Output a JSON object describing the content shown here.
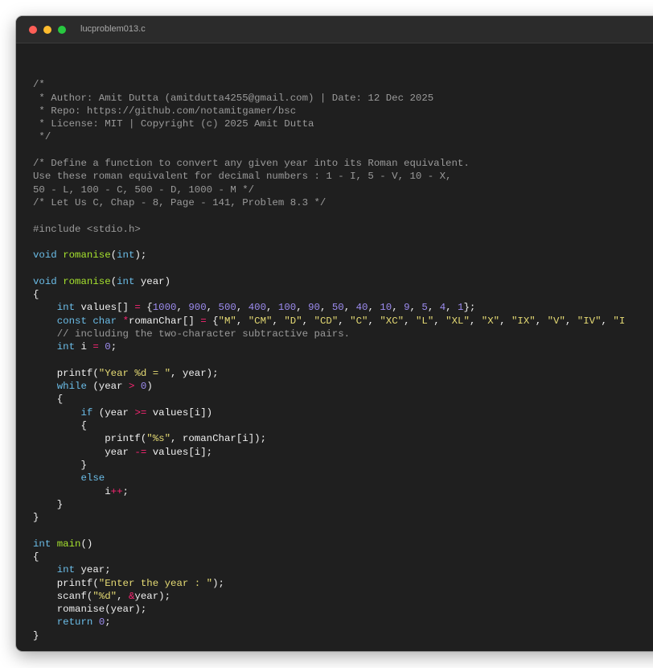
{
  "window": {
    "title": "lucproblem013.c",
    "colors": {
      "background": "#1f1f1f",
      "titlebar": "#2b2b2b",
      "close": "#ff5f57",
      "minimize": "#febc2e",
      "maximize": "#28c840"
    },
    "controls": [
      "close-icon",
      "minimize-icon",
      "maximize-icon"
    ]
  },
  "syntax_colors": {
    "comment": "#9a9a9a",
    "keyword": "#6bbde8",
    "function": "#a6e22e",
    "number": "#9d8cf0",
    "string": "#e6db74",
    "operator": "#f92672",
    "plain": "#f0f0f0"
  },
  "code_lines": [
    [],
    [
      [
        "c",
        "/*"
      ]
    ],
    [
      [
        "c",
        " * Author: Amit Dutta (amitdutta4255@gmail.com) | Date: 12 Dec 2025"
      ]
    ],
    [
      [
        "c",
        " * Repo: https://github.com/notamitgamer/bsc"
      ]
    ],
    [
      [
        "c",
        " * License: MIT | Copyright (c) 2025 Amit Dutta"
      ]
    ],
    [
      [
        "c",
        " */"
      ]
    ],
    [],
    [
      [
        "c",
        "/* Define a function to convert any given year into its Roman equivalent."
      ]
    ],
    [
      [
        "c",
        "Use these roman equivalent for decimal numbers : 1 - I, 5 - V, 10 - X,"
      ]
    ],
    [
      [
        "c",
        "50 - L, 100 - C, 500 - D, 1000 - M */"
      ]
    ],
    [
      [
        "c",
        "/* Let Us C, Chap - 8, Page - 141, Problem 8.3 */"
      ]
    ],
    [],
    [
      [
        "pp",
        "#include <stdio.h>"
      ]
    ],
    [],
    [
      [
        "k",
        "void"
      ],
      [
        "p",
        " "
      ],
      [
        "f",
        "romanise"
      ],
      [
        "p",
        "("
      ],
      [
        "k",
        "int"
      ],
      [
        "p",
        ");"
      ]
    ],
    [],
    [
      [
        "k",
        "void"
      ],
      [
        "p",
        " "
      ],
      [
        "f",
        "romanise"
      ],
      [
        "p",
        "("
      ],
      [
        "k",
        "int"
      ],
      [
        "p",
        " year)"
      ]
    ],
    [
      [
        "p",
        "{"
      ]
    ],
    [
      [
        "p",
        "    "
      ],
      [
        "k",
        "int"
      ],
      [
        "p",
        " values[] "
      ],
      [
        "o",
        "="
      ],
      [
        "p",
        " {"
      ],
      [
        "n",
        "1000"
      ],
      [
        "p",
        ", "
      ],
      [
        "n",
        "900"
      ],
      [
        "p",
        ", "
      ],
      [
        "n",
        "500"
      ],
      [
        "p",
        ", "
      ],
      [
        "n",
        "400"
      ],
      [
        "p",
        ", "
      ],
      [
        "n",
        "100"
      ],
      [
        "p",
        ", "
      ],
      [
        "n",
        "90"
      ],
      [
        "p",
        ", "
      ],
      [
        "n",
        "50"
      ],
      [
        "p",
        ", "
      ],
      [
        "n",
        "40"
      ],
      [
        "p",
        ", "
      ],
      [
        "n",
        "10"
      ],
      [
        "p",
        ", "
      ],
      [
        "n",
        "9"
      ],
      [
        "p",
        ", "
      ],
      [
        "n",
        "5"
      ],
      [
        "p",
        ", "
      ],
      [
        "n",
        "4"
      ],
      [
        "p",
        ", "
      ],
      [
        "n",
        "1"
      ],
      [
        "p",
        "};"
      ]
    ],
    [
      [
        "p",
        "    "
      ],
      [
        "k",
        "const"
      ],
      [
        "p",
        " "
      ],
      [
        "k",
        "char"
      ],
      [
        "p",
        " "
      ],
      [
        "o",
        "*"
      ],
      [
        "p",
        "romanChar[] "
      ],
      [
        "o",
        "="
      ],
      [
        "p",
        " {"
      ],
      [
        "s",
        "\"M\""
      ],
      [
        "p",
        ", "
      ],
      [
        "s",
        "\"CM\""
      ],
      [
        "p",
        ", "
      ],
      [
        "s",
        "\"D\""
      ],
      [
        "p",
        ", "
      ],
      [
        "s",
        "\"CD\""
      ],
      [
        "p",
        ", "
      ],
      [
        "s",
        "\"C\""
      ],
      [
        "p",
        ", "
      ],
      [
        "s",
        "\"XC\""
      ],
      [
        "p",
        ", "
      ],
      [
        "s",
        "\"L\""
      ],
      [
        "p",
        ", "
      ],
      [
        "s",
        "\"XL\""
      ],
      [
        "p",
        ", "
      ],
      [
        "s",
        "\"X\""
      ],
      [
        "p",
        ", "
      ],
      [
        "s",
        "\"IX\""
      ],
      [
        "p",
        ", "
      ],
      [
        "s",
        "\"V\""
      ],
      [
        "p",
        ", "
      ],
      [
        "s",
        "\"IV\""
      ],
      [
        "p",
        ", "
      ],
      [
        "s",
        "\"I"
      ]
    ],
    [
      [
        "p",
        "    "
      ],
      [
        "c",
        "// including the two-character subtractive pairs."
      ]
    ],
    [
      [
        "p",
        "    "
      ],
      [
        "k",
        "int"
      ],
      [
        "p",
        " i "
      ],
      [
        "o",
        "="
      ],
      [
        "p",
        " "
      ],
      [
        "n",
        "0"
      ],
      [
        "p",
        ";"
      ]
    ],
    [],
    [
      [
        "p",
        "    printf("
      ],
      [
        "s",
        "\"Year %d = \""
      ],
      [
        "p",
        ", year);"
      ]
    ],
    [
      [
        "p",
        "    "
      ],
      [
        "k",
        "while"
      ],
      [
        "p",
        " (year "
      ],
      [
        "o",
        ">"
      ],
      [
        "p",
        " "
      ],
      [
        "n",
        "0"
      ],
      [
        "p",
        ")"
      ]
    ],
    [
      [
        "p",
        "    {"
      ]
    ],
    [
      [
        "p",
        "        "
      ],
      [
        "k",
        "if"
      ],
      [
        "p",
        " (year "
      ],
      [
        "o",
        ">="
      ],
      [
        "p",
        " values[i])"
      ]
    ],
    [
      [
        "p",
        "        {"
      ]
    ],
    [
      [
        "p",
        "            printf("
      ],
      [
        "s",
        "\"%s\""
      ],
      [
        "p",
        ", romanChar[i]);"
      ]
    ],
    [
      [
        "p",
        "            year "
      ],
      [
        "o",
        "-="
      ],
      [
        "p",
        " values[i];"
      ]
    ],
    [
      [
        "p",
        "        }"
      ]
    ],
    [
      [
        "p",
        "        "
      ],
      [
        "k",
        "else"
      ]
    ],
    [
      [
        "p",
        "            i"
      ],
      [
        "o",
        "++"
      ],
      [
        "p",
        ";"
      ]
    ],
    [
      [
        "p",
        "    }"
      ]
    ],
    [
      [
        "p",
        "}"
      ]
    ],
    [],
    [
      [
        "k",
        "int"
      ],
      [
        "p",
        " "
      ],
      [
        "f",
        "main"
      ],
      [
        "p",
        "()"
      ]
    ],
    [
      [
        "p",
        "{"
      ]
    ],
    [
      [
        "p",
        "    "
      ],
      [
        "k",
        "int"
      ],
      [
        "p",
        " year;"
      ]
    ],
    [
      [
        "p",
        "    printf("
      ],
      [
        "s",
        "\"Enter the year : \""
      ],
      [
        "p",
        ");"
      ]
    ],
    [
      [
        "p",
        "    scanf("
      ],
      [
        "s",
        "\"%d\""
      ],
      [
        "p",
        ", "
      ],
      [
        "o",
        "&"
      ],
      [
        "p",
        "year);"
      ]
    ],
    [
      [
        "p",
        "    romanise(year);"
      ]
    ],
    [
      [
        "p",
        "    "
      ],
      [
        "k",
        "return"
      ],
      [
        "p",
        " "
      ],
      [
        "n",
        "0"
      ],
      [
        "p",
        ";"
      ]
    ],
    [
      [
        "p",
        "}"
      ]
    ]
  ]
}
